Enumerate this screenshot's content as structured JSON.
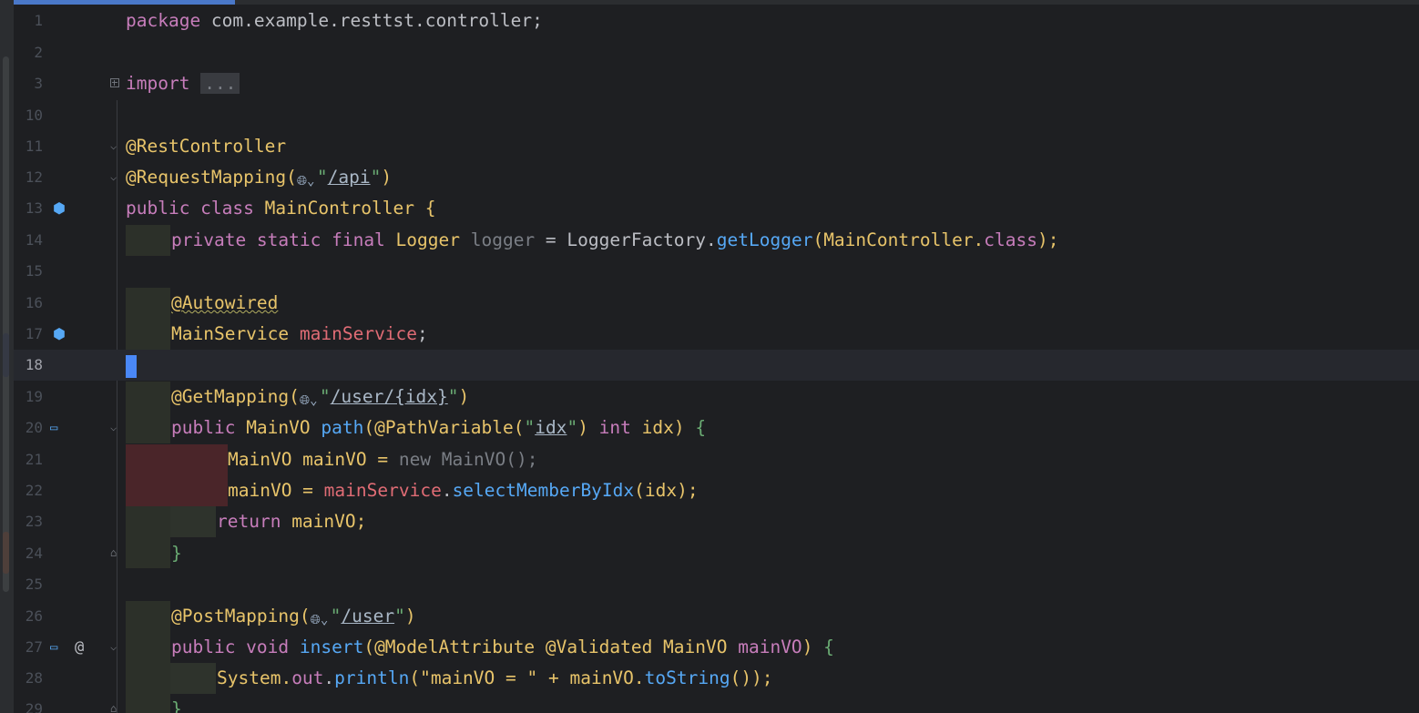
{
  "editor": {
    "file_language": "java",
    "current_line": 18,
    "lines": [
      {
        "n": "1"
      },
      {
        "n": "2"
      },
      {
        "n": "3"
      },
      {
        "n": "10"
      },
      {
        "n": "11"
      },
      {
        "n": "12"
      },
      {
        "n": "13"
      },
      {
        "n": "14"
      },
      {
        "n": "15"
      },
      {
        "n": "16"
      },
      {
        "n": "17"
      },
      {
        "n": "18"
      },
      {
        "n": "19"
      },
      {
        "n": "20"
      },
      {
        "n": "21"
      },
      {
        "n": "22"
      },
      {
        "n": "23"
      },
      {
        "n": "24"
      },
      {
        "n": "25"
      },
      {
        "n": "26"
      },
      {
        "n": "27"
      },
      {
        "n": "28"
      },
      {
        "n": "29"
      }
    ],
    "code": {
      "l1_kw": "package",
      "l1_rest": " com.example.resttst.controller;",
      "l3_kw": "import",
      "l3_dots": "...",
      "l11": "@RestController",
      "l12_ann": "@RequestMapping(",
      "l12_str": "/api",
      "l13_kw": "public class",
      "l13_name": " MainController ",
      "l13_brace": "{",
      "l14_kw": "private static final",
      "l14_type": " Logger ",
      "l14_var": "logger",
      "l14_eq": " = LoggerFactory.",
      "l14_fn": "getLogger",
      "l14_arg": "(MainController.",
      "l14_cls": "class",
      "l14_end": ");",
      "l16": "@Autowired",
      "l17_type": "MainService ",
      "l17_var": "mainService",
      "l17_end": ";",
      "l19_ann": "@GetMapping(",
      "l19_str": "/user/{idx}",
      "l20_kw": "public",
      "l20_type": " MainVO ",
      "l20_fn": "path",
      "l20_ann": "(@PathVariable(",
      "l20_str": "idx",
      "l20_kw2": " int",
      "l20_rest": " idx) ",
      "l20_brace": "{",
      "l21_a": "MainVO mainVO = ",
      "l21_b": "new MainVO();",
      "l22_a": "mainVO = ",
      "l22_var": "mainService",
      "l22_dot": ".",
      "l22_fn": "selectMemberByIdx",
      "l22_end": "(idx);",
      "l23_kw": "return",
      "l23_rest": " mainVO;",
      "l24": "}",
      "l26_ann": "@PostMapping(",
      "l26_str": "/user",
      "l27_kw": "public void",
      "l27_fn": " insert",
      "l27_ann": "(@ModelAttribute @Validated",
      "l27_type": " MainVO ",
      "l27_var": "mainVO",
      "l27_end": ") ",
      "l27_brace": "{",
      "l28_a": "System.",
      "l28_out": "out",
      "l28_dot": ".",
      "l28_fn": "println",
      "l28_str": "(\"mainVO = \"",
      "l28_b": " + mainVO.",
      "l28_fn2": "toString",
      "l28_end": "());",
      "l29": "}"
    },
    "gutter_icons": {
      "l13": "bean-icon",
      "l17": "autowired-bean-icon",
      "l20": "endpoint-icon",
      "l27": "endpoint-icon",
      "l27_at": "@"
    },
    "colors": {
      "background": "#1e1f22",
      "keyword": "#cf8e6d",
      "annotation": "#b3ae60",
      "string": "#6aab73",
      "function": "#56a8f5",
      "caret": "#4a88f7"
    }
  }
}
